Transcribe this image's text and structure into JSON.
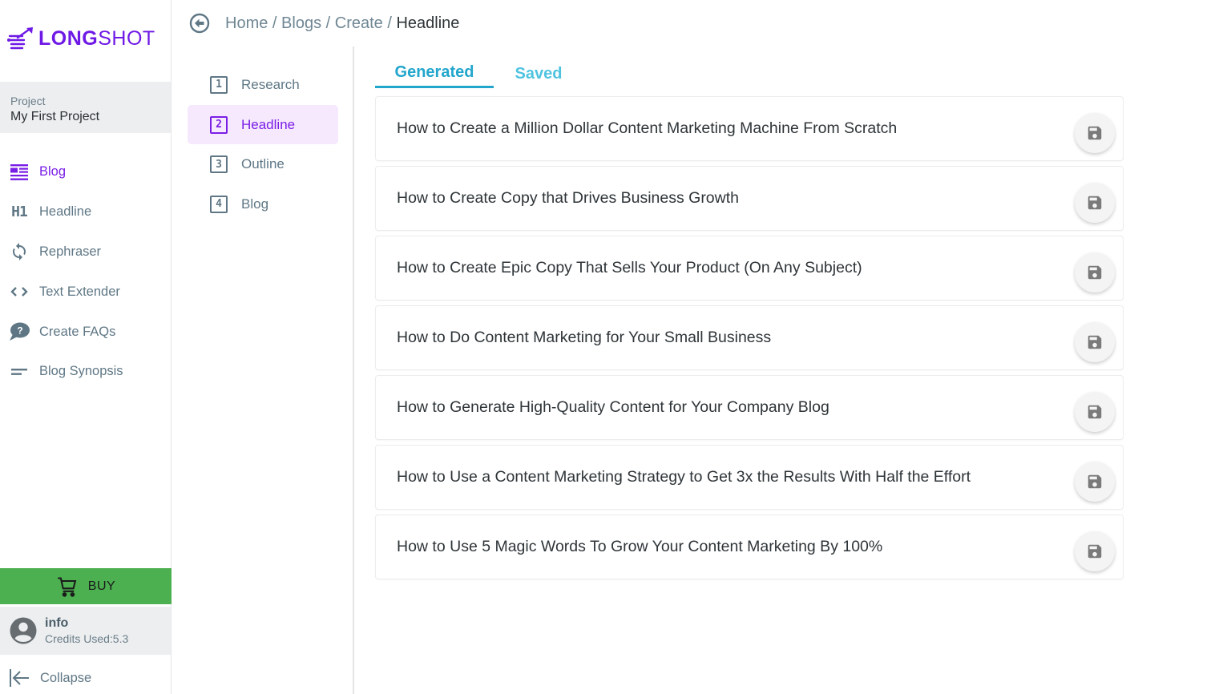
{
  "brand": {
    "name_bold": "LONG",
    "name_light": "SHOT",
    "color": "#6f19e6"
  },
  "project": {
    "label": "Project",
    "name": "My First Project"
  },
  "sidebar": {
    "items": [
      {
        "label": "Blog",
        "icon": "blog-icon",
        "active": true
      },
      {
        "label": "Headline",
        "icon": "h1-icon",
        "active": false
      },
      {
        "label": "Rephraser",
        "icon": "sync-icon",
        "active": false
      },
      {
        "label": "Text Extender",
        "icon": "code-brackets-icon",
        "active": false
      },
      {
        "label": "Create FAQs",
        "icon": "question-bubble-icon",
        "active": false
      },
      {
        "label": "Blog Synopsis",
        "icon": "short-text-icon",
        "active": false
      }
    ],
    "buy_label": "BUY",
    "user": {
      "name": "info",
      "credits": "Credits Used:5.3"
    },
    "collapse_label": "Collapse"
  },
  "breadcrumb": {
    "items": [
      "Home",
      "Blogs",
      "Create"
    ],
    "separator": "/",
    "current": "Headline"
  },
  "steps": [
    {
      "num": "1",
      "label": "Research",
      "active": false
    },
    {
      "num": "2",
      "label": "Headline",
      "active": true
    },
    {
      "num": "3",
      "label": "Outline",
      "active": false
    },
    {
      "num": "4",
      "label": "Blog",
      "active": false
    }
  ],
  "tabs": {
    "generated": "Generated",
    "saved": "Saved",
    "active": "generated"
  },
  "headlines": [
    "How to Create a Million Dollar Content Marketing Machine From Scratch",
    "How to Create Copy that Drives Business Growth",
    "How to Create Epic Copy That Sells Your Product (On Any Subject)",
    "How to Do Content Marketing for Your Small Business",
    "How to Generate High-Quality Content for Your Company Blog",
    "How to Use a Content Marketing Strategy to Get 3x the Results With Half the Effort",
    "How to Use 5 Magic Words To Grow Your Content Marketing By 100%"
  ],
  "colors": {
    "accent_purple": "#7a1ee6",
    "tab_active": "#22a6cc",
    "buy_green": "#4caf50",
    "step_active_bg": "#f6e8fd"
  }
}
